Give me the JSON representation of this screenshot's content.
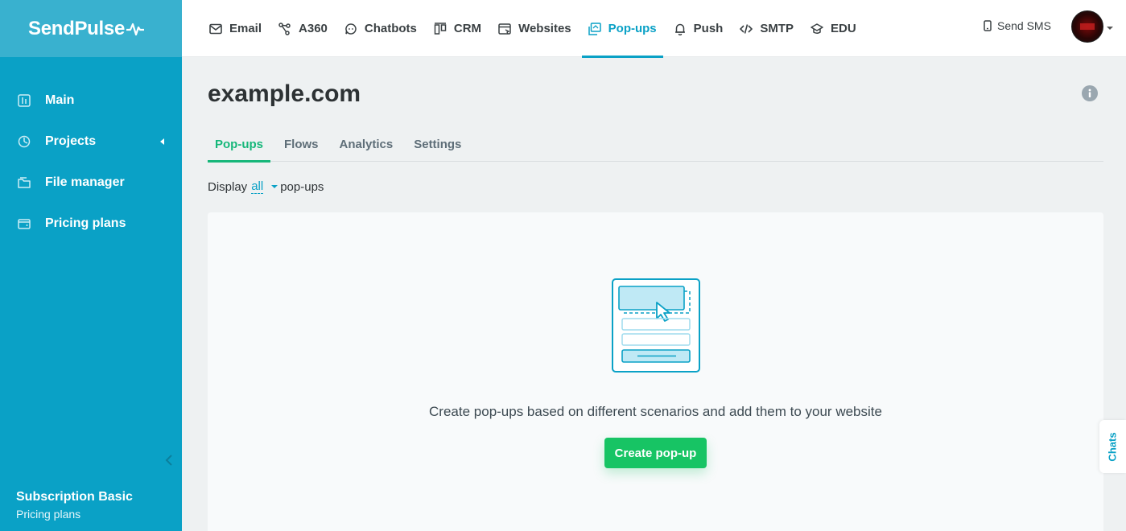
{
  "brand": {
    "name": "SendPulse"
  },
  "sidebar": {
    "items": [
      {
        "label": "Main",
        "icon": "dashboard-icon"
      },
      {
        "label": "Projects",
        "icon": "projects-icon"
      },
      {
        "label": "File manager",
        "icon": "folder-icon"
      },
      {
        "label": "Pricing plans",
        "icon": "wallet-icon"
      }
    ],
    "subscription_title": "Subscription Basic",
    "subscription_link": "Pricing plans"
  },
  "topnav": {
    "items": [
      {
        "label": "Email",
        "icon": "envelope-icon"
      },
      {
        "label": "A360",
        "icon": "nodes-icon"
      },
      {
        "label": "Chatbots",
        "icon": "chat-icon"
      },
      {
        "label": "CRM",
        "icon": "kanban-icon"
      },
      {
        "label": "Websites",
        "icon": "browser-icon"
      },
      {
        "label": "Pop-ups",
        "icon": "popup-icon",
        "active": true
      },
      {
        "label": "Push",
        "icon": "bell-icon"
      },
      {
        "label": "SMTP",
        "icon": "code-icon"
      },
      {
        "label": "EDU",
        "icon": "graduation-cap-icon"
      }
    ],
    "sms_label": "Send SMS"
  },
  "main": {
    "title": "example.com",
    "tabs": [
      {
        "label": "Pop-ups",
        "active": true
      },
      {
        "label": "Flows"
      },
      {
        "label": "Analytics"
      },
      {
        "label": "Settings"
      }
    ],
    "filter": {
      "prefix": "Display",
      "value": "all",
      "suffix": "pop-ups"
    },
    "empty_text": "Create pop-ups based on different scenarios and add them to your website",
    "create_button": "Create pop-up"
  },
  "chats_label": "Chats",
  "colors": {
    "primary": "#0aa1c6",
    "success": "#17c464",
    "tab_active": "#16b77a"
  }
}
